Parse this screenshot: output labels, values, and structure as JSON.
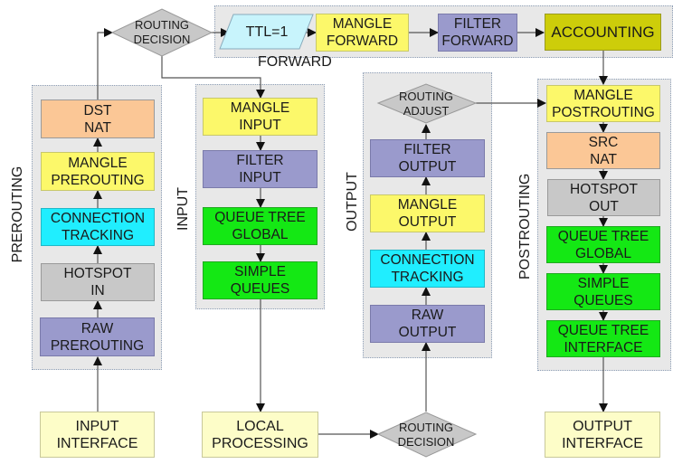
{
  "groups": {
    "forward": "FORWARD",
    "prerouting": "PREROUTING",
    "input": "INPUT",
    "output": "OUTPUT",
    "postrouting": "POSTROUTING"
  },
  "forward": {
    "routing_decision": [
      "ROUTING",
      "DECISION"
    ],
    "ttl": "TTL=1",
    "mangle_forward": [
      "MANGLE",
      "FORWARD"
    ],
    "filter_forward": [
      "FILTER",
      "FORWARD"
    ],
    "accounting": "ACCOUNTING"
  },
  "prerouting": {
    "dst_nat": [
      "DST",
      "NAT"
    ],
    "mangle_prerouting": [
      "MANGLE",
      "PREROUTING"
    ],
    "connection_tracking": [
      "CONNECTION",
      "TRACKING"
    ],
    "hotspot_in": [
      "HOTSPOT",
      "IN"
    ],
    "raw_prerouting": [
      "RAW",
      "PREROUTING"
    ]
  },
  "input": {
    "mangle_input": [
      "MANGLE",
      "INPUT"
    ],
    "filter_input": [
      "FILTER",
      "INPUT"
    ],
    "queue_tree_global": [
      "QUEUE TREE",
      "GLOBAL"
    ],
    "simple_queues": [
      "SIMPLE",
      "QUEUES"
    ]
  },
  "output": {
    "routing_adjust": [
      "ROUTING",
      "ADJUST"
    ],
    "filter_output": [
      "FILTER",
      "OUTPUT"
    ],
    "mangle_output": [
      "MANGLE",
      "OUTPUT"
    ],
    "connection_tracking": [
      "CONNECTION",
      "TRACKING"
    ],
    "raw_output": [
      "RAW",
      "OUTPUT"
    ]
  },
  "postrouting": {
    "mangle_postrouting": [
      "MANGLE",
      "POSTROUTING"
    ],
    "src_nat": [
      "SRC",
      "NAT"
    ],
    "hotspot_out": [
      "HOTSPOT",
      "OUT"
    ],
    "queue_tree_global": [
      "QUEUE TREE",
      "GLOBAL"
    ],
    "simple_queues": [
      "SIMPLE",
      "QUEUES"
    ],
    "queue_tree_interface": [
      "QUEUE TREE",
      "INTERFACE"
    ]
  },
  "bottom": {
    "input_interface": [
      "INPUT",
      "INTERFACE"
    ],
    "local_processing": [
      "LOCAL",
      "PROCESSING"
    ],
    "routing_decision": [
      "ROUTING",
      "DECISION"
    ],
    "output_interface": [
      "OUTPUT",
      "INTERFACE"
    ]
  },
  "colors": {
    "group_bg": "#e8e8e8",
    "nat": "#fbc796",
    "mangle": "#fcf86a",
    "conntrack": "#20eeff",
    "hotspot": "#c8c8c8",
    "filter_raw": "#9a9acc",
    "queue": "#14e814",
    "accounting": "#cdcd0a",
    "interface": "#fdfdc8",
    "ttl": "#c8f4fc",
    "decision": "#c8c8c8"
  }
}
